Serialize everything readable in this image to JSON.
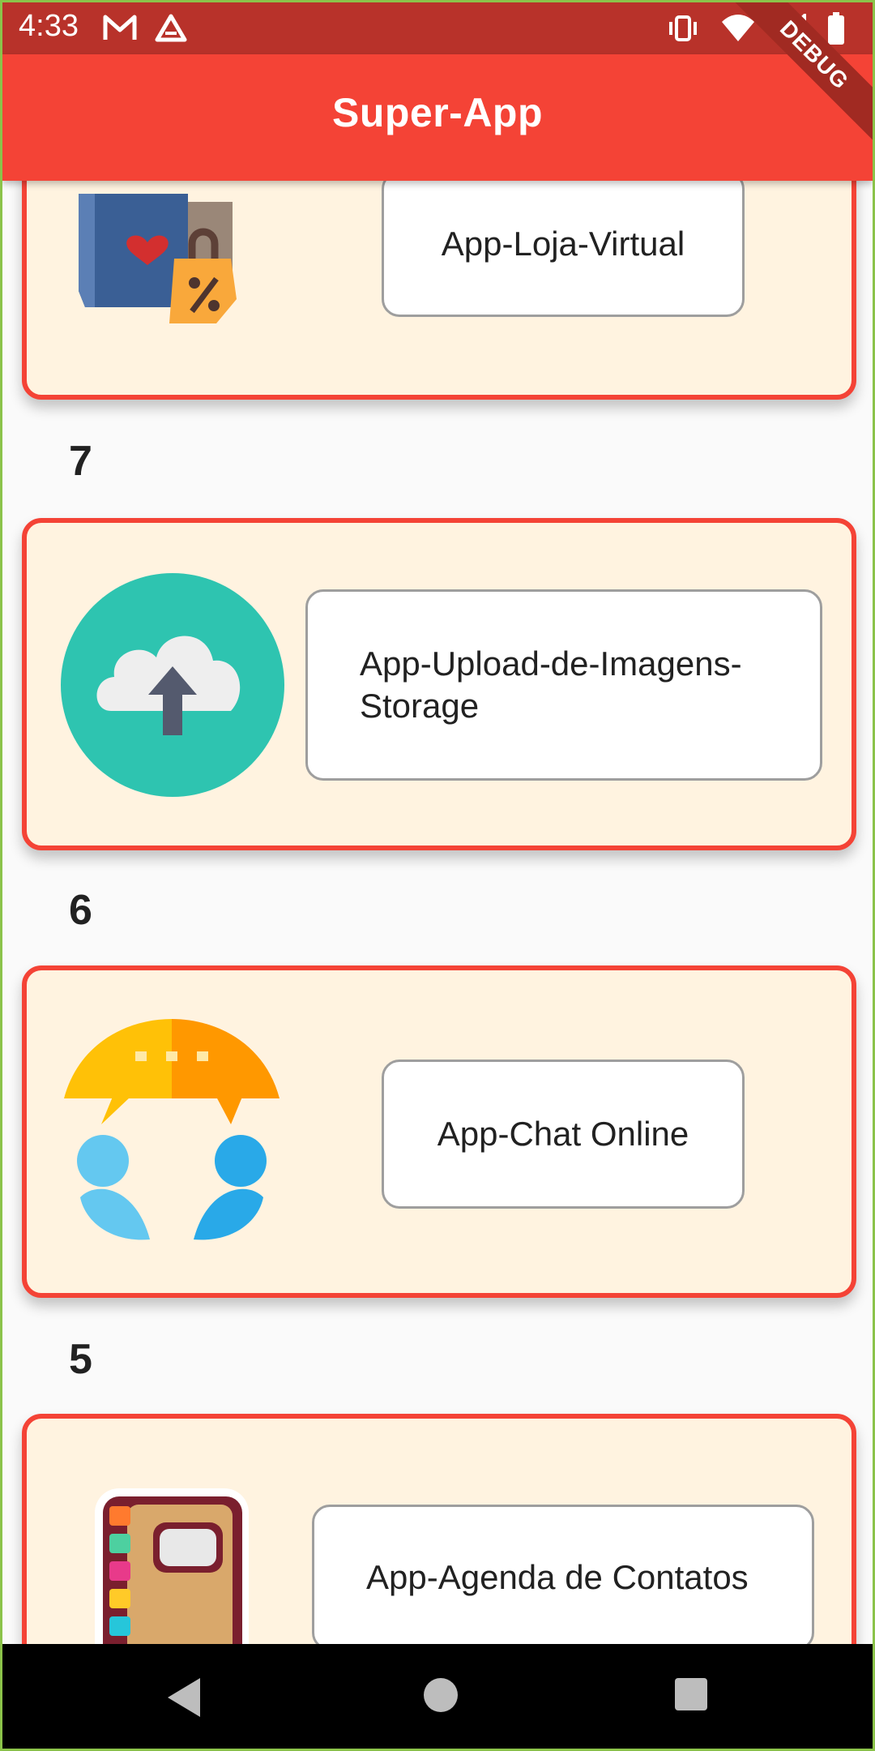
{
  "status_bar": {
    "time": "4:33",
    "left_icons": [
      "gmail-icon",
      "drive-icon"
    ],
    "right_icons": [
      "vibrate-icon",
      "wifi-icon",
      "signal-icon",
      "battery-icon"
    ]
  },
  "app_bar": {
    "title": "Super-App",
    "debug_label": "DEBUG"
  },
  "list": {
    "items": [
      {
        "number": "",
        "label": "App-Loja-Virtual",
        "icon": "shopping-bags-icon"
      },
      {
        "number": "7",
        "label": "App-Upload-de-Imagens-Storage",
        "icon": "cloud-upload-icon"
      },
      {
        "number": "6",
        "label": "App-Chat Online",
        "icon": "chat-users-icon"
      },
      {
        "number": "5",
        "label": "App-Agenda de Contatos",
        "icon": "contact-book-icon"
      }
    ]
  },
  "nav_bar": {
    "icons": [
      "back-icon",
      "home-icon",
      "recent-apps-icon"
    ]
  },
  "colors": {
    "primary": "#f44336",
    "status_bar": "#b8322a",
    "card_bg": "#fff3e0"
  }
}
